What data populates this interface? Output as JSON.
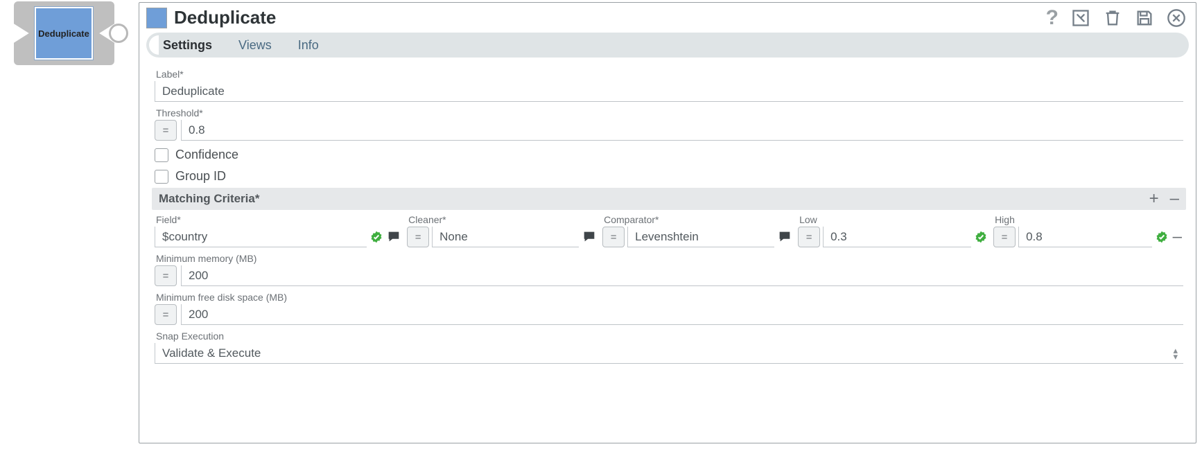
{
  "snap": {
    "label": "Deduplicate"
  },
  "header": {
    "title": "Deduplicate"
  },
  "tabs": {
    "settings": "Settings",
    "views": "Views",
    "info": "Info"
  },
  "form": {
    "label_label": "Label*",
    "label_value": "Deduplicate",
    "threshold_label": "Threshold*",
    "threshold_value": "0.8",
    "confidence_label": "Confidence",
    "groupid_label": "Group ID",
    "criteria_label": "Matching Criteria*",
    "criteria_cols": {
      "field": "Field*",
      "cleaner": "Cleaner*",
      "comparator": "Comparator*",
      "low": "Low",
      "high": "High"
    },
    "criteria_row": {
      "field": "$country",
      "cleaner": "None",
      "comparator": "Levenshtein",
      "low": "0.3",
      "high": "0.8"
    },
    "min_mem_label": "Minimum memory (MB)",
    "min_mem_value": "200",
    "min_disk_label": "Minimum free disk space (MB)",
    "min_disk_value": "200",
    "exec_label": "Snap Execution",
    "exec_value": "Validate & Execute"
  },
  "glyphs": {
    "eq": "=",
    "plus": "+",
    "minus": "–"
  }
}
